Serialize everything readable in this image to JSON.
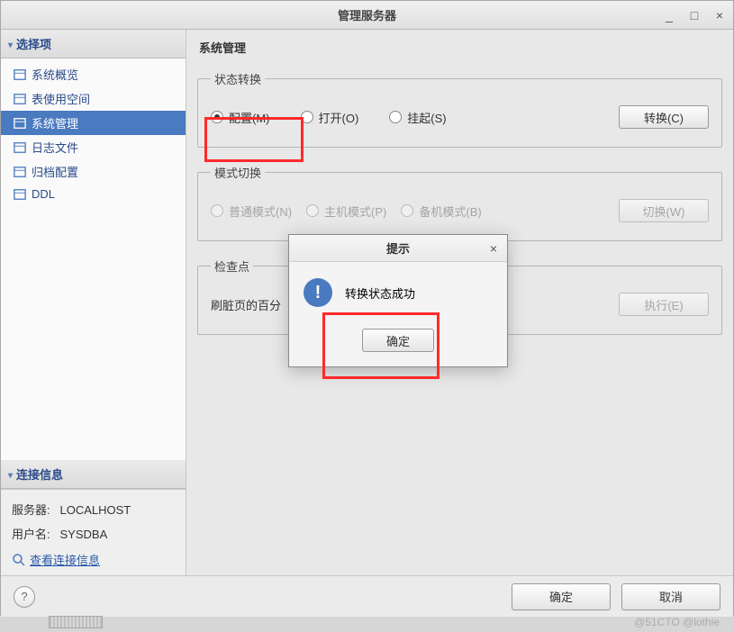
{
  "titlebar": {
    "title": "管理服务器"
  },
  "sidebar": {
    "select_header": "选择项",
    "items": [
      {
        "label": "系统概览"
      },
      {
        "label": "表使用空间"
      },
      {
        "label": "系统管理"
      },
      {
        "label": "日志文件"
      },
      {
        "label": "归档配置"
      },
      {
        "label": "DDL"
      }
    ],
    "conn_header": "连接信息",
    "server_label": "服务器:",
    "server_value": "LOCALHOST",
    "user_label": "用户名:",
    "user_value": "SYSDBA",
    "conn_link": "查看连接信息"
  },
  "main": {
    "title": "系统管理",
    "group_state": {
      "legend": "状态转换",
      "options": [
        {
          "label": "配置(M)"
        },
        {
          "label": "打开(O)"
        },
        {
          "label": "挂起(S)"
        }
      ],
      "button": "转换(C)"
    },
    "group_mode": {
      "legend": "模式切换",
      "options": [
        {
          "label": "普通模式(N)"
        },
        {
          "label": "主机模式(P)"
        },
        {
          "label": "备机模式(B)"
        }
      ],
      "button": "切换(W)"
    },
    "group_checkpoint": {
      "legend": "检查点",
      "label": "刷脏页的百分",
      "button": "执行(E)"
    }
  },
  "dialog": {
    "title": "提示",
    "message": "转换状态成功",
    "ok": "确定"
  },
  "footer": {
    "ok": "确定",
    "cancel": "取消"
  },
  "watermark": "@51CTO @lothie"
}
